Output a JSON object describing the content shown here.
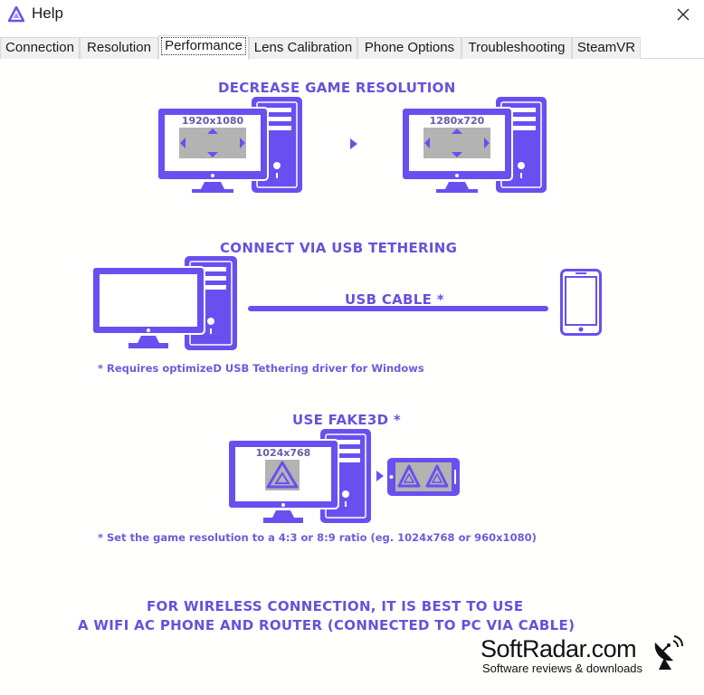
{
  "window": {
    "title": "Help",
    "app_icon": "triangle-logo-icon",
    "close_icon": "close-icon"
  },
  "tabs": [
    {
      "label": "Connection",
      "active": false
    },
    {
      "label": "Resolution",
      "active": false
    },
    {
      "label": "Performance",
      "active": true
    },
    {
      "label": "Lens Calibration",
      "active": false
    },
    {
      "label": "Phone Options",
      "active": false
    },
    {
      "label": "Troubleshooting",
      "active": false
    },
    {
      "label": "SteamVR",
      "active": false
    }
  ],
  "performance": {
    "section1": {
      "heading": "DECREASE GAME RESOLUTION",
      "from_resolution": "1920x1080",
      "to_resolution": "1280x720"
    },
    "section2": {
      "heading": "CONNECT VIA USB TETHERING",
      "cable_label": "USB CABLE *",
      "note": "* Requires optimizeD USB Tethering driver for Windows"
    },
    "section3": {
      "heading": "USE FAKE3D *",
      "resolution": "1024x768",
      "note": "* Set the game resolution to a 4:3 or 8:9 ratio (eg. 1024x768 or 960x1080)"
    },
    "wireless_tip": {
      "line1": "FOR WIRELESS CONNECTION, IT IS BEST TO USE",
      "line2": "A WIFI AC PHONE AND ROUTER (CONNECTED TO PC VIA CABLE)"
    }
  },
  "watermark": {
    "title": "SoftRadar.com",
    "subtitle": "Software reviews & downloads",
    "icon": "satellite-dish-icon"
  },
  "colors": {
    "accent": "#6a4ff0",
    "screen_grey": "#b3b3b3",
    "heading": "#6a50dc"
  }
}
